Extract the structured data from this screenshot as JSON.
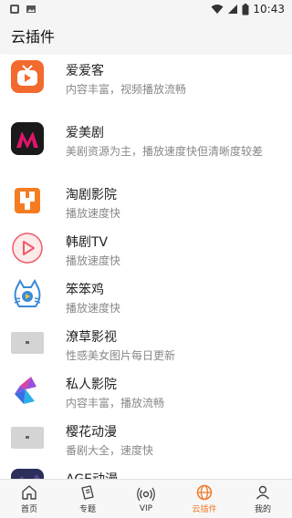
{
  "status": {
    "time": "10:43"
  },
  "header": {
    "title": "云插件"
  },
  "plugins": [
    {
      "name": "爱爱客",
      "desc": "内容丰富，视频播放流畅",
      "icon": "tv-logo-icon",
      "color": "#f26a2e"
    },
    {
      "name": "爱美剧",
      "desc": "美剧资源为主，播放速度快但清晰度较差",
      "icon": "m-logo-icon",
      "color": "#e0146b"
    },
    {
      "name": "淘剧影院",
      "desc": "播放速度快",
      "icon": "s-logo-icon",
      "color": "#f57c21"
    },
    {
      "name": "韩剧TV",
      "desc": "播放速度快",
      "icon": "play-circle-icon",
      "color": "#f05a6a"
    },
    {
      "name": "笨笨鸡",
      "desc": "播放速度快",
      "icon": "cat-logo-icon",
      "color": "#3a8ad6"
    },
    {
      "name": "潦草影视",
      "desc": "性感美女图片每日更新",
      "icon": "placeholder-image-icon",
      "color": "#d4d4d4"
    },
    {
      "name": "私人影院",
      "desc": "内容丰富，播放流畅",
      "icon": "gradient-logo-icon",
      "color": "#7a5ce0"
    },
    {
      "name": "樱花动漫",
      "desc": "番剧大全，速度快",
      "icon": "placeholder-image-icon",
      "color": "#d4d4d4"
    },
    {
      "name": "AGE动漫",
      "desc": "",
      "icon": "anime-thumb-icon",
      "color": "#2b2f5a"
    }
  ],
  "nav": [
    {
      "label": "首页",
      "icon": "home-icon",
      "active": false
    },
    {
      "label": "专题",
      "icon": "topic-icon",
      "active": false
    },
    {
      "label": "VIP",
      "icon": "vip-icon",
      "active": false
    },
    {
      "label": "云插件",
      "icon": "globe-icon",
      "active": true
    },
    {
      "label": "我的",
      "icon": "user-icon",
      "active": false
    }
  ]
}
